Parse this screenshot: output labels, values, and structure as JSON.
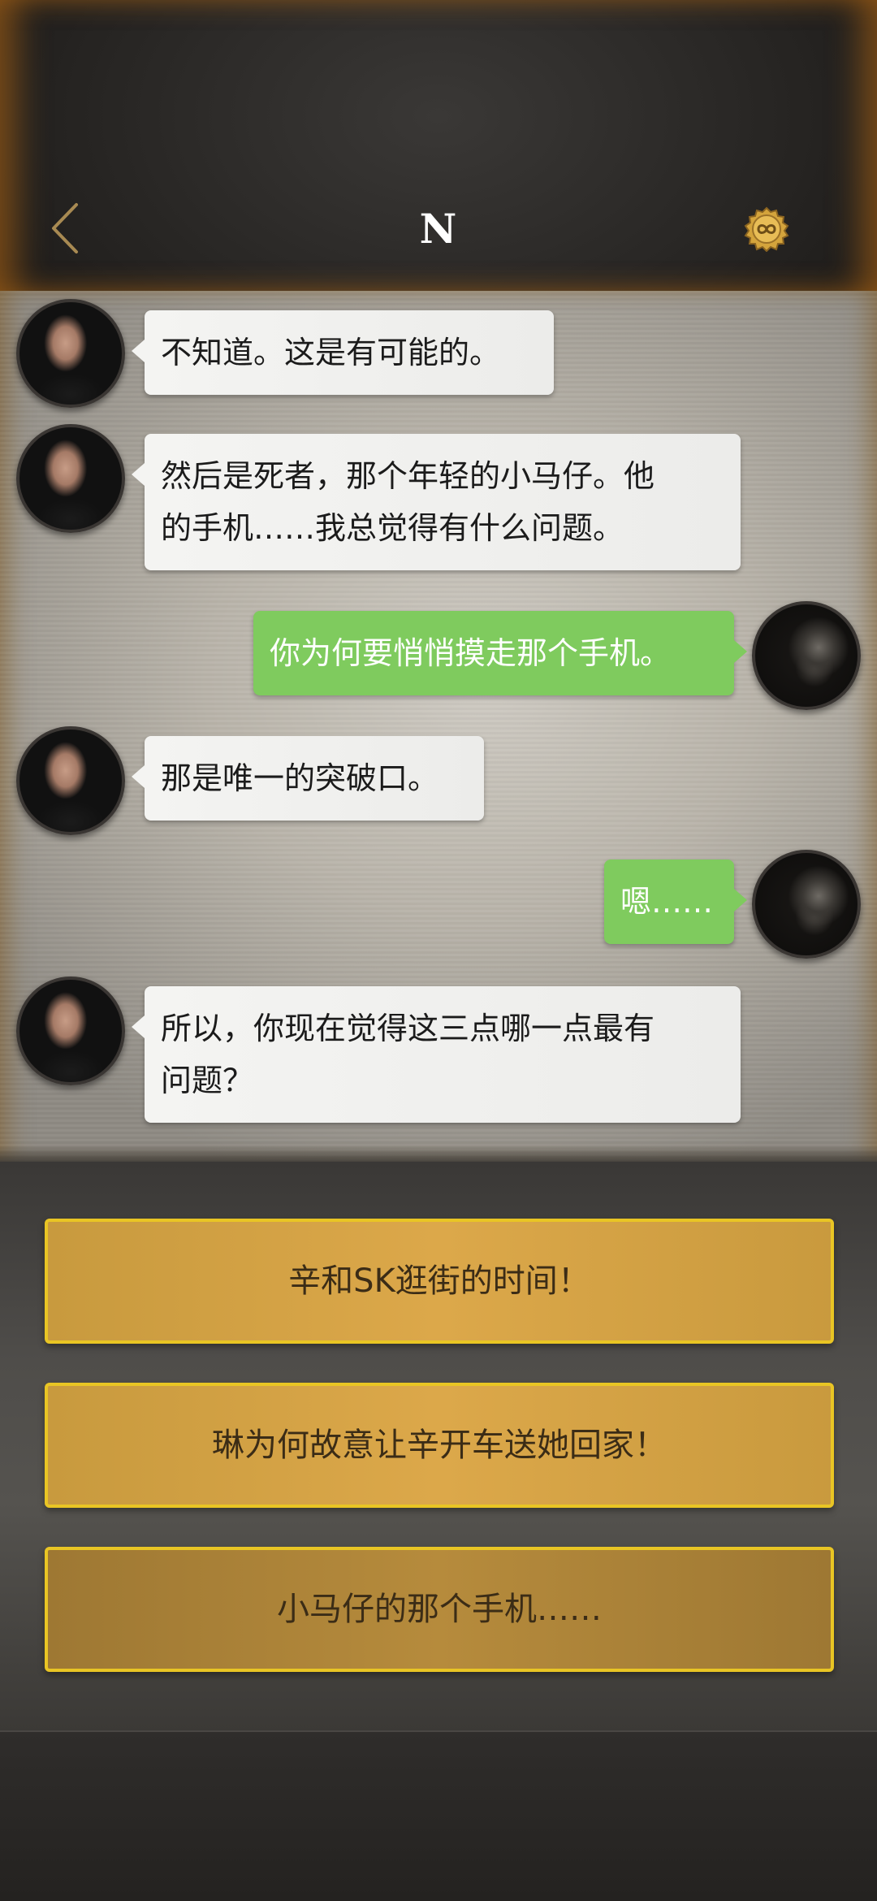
{
  "header": {
    "title": "N",
    "back_icon": "chevron-left-icon",
    "coin_icon": "infinity-coin-icon"
  },
  "messages": [
    {
      "side": "left",
      "text": "不知道。这是有可能的。"
    },
    {
      "side": "left",
      "line1": "然后是死者，那个年轻的小马仔。他",
      "line2": "的手机……我总觉得有什么问题。"
    },
    {
      "side": "right",
      "text": "你为何要悄悄摸走那个手机。"
    },
    {
      "side": "left",
      "text": "那是唯一的突破口。"
    },
    {
      "side": "right",
      "text": "嗯……"
    },
    {
      "side": "left",
      "line1": "所以，你现在觉得这三点哪一点最有",
      "line2": "问题？"
    }
  ],
  "options": [
    {
      "label": "辛和SK逛街的时间！"
    },
    {
      "label": "琳为何故意让辛开车送她回家！"
    },
    {
      "label": "小马仔的那个手机……"
    }
  ],
  "colors": {
    "npc_bubble": "#f4f4f2",
    "player_bubble": "#7fcb5e",
    "option_fill": "#dca84a",
    "option_border": "#e9c524",
    "accent_glow": "#be6e14"
  }
}
